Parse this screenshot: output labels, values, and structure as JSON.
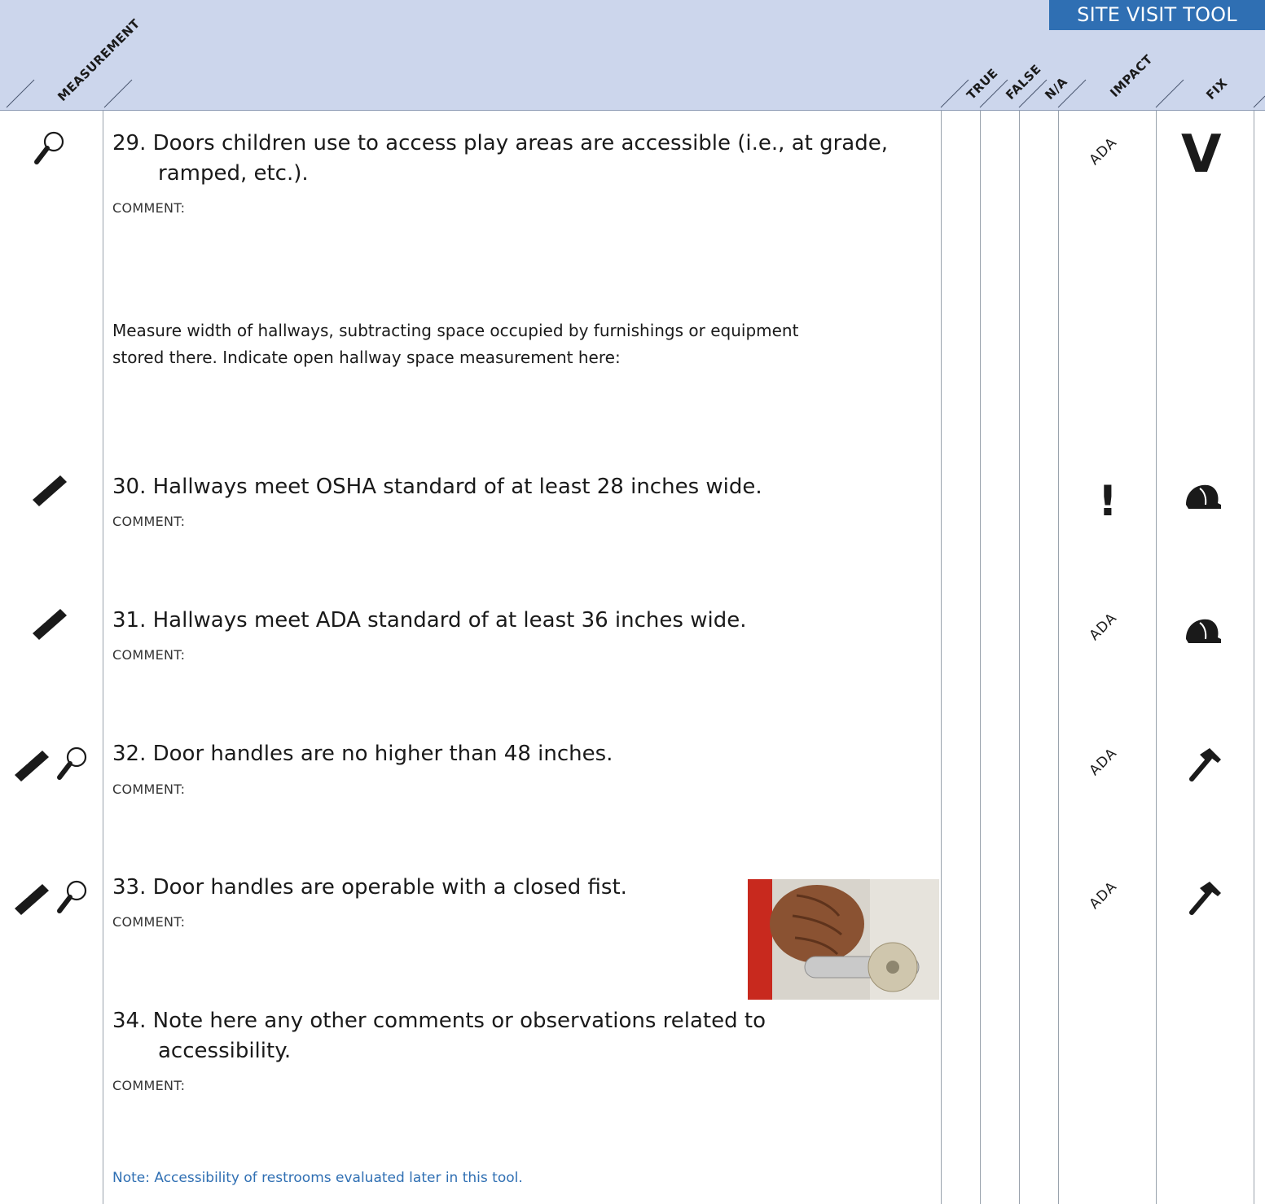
{
  "banner": "SITE VISIT TOOL",
  "columns": {
    "measurement": "MEASUREMENT",
    "true": "TRUE",
    "false": "FALSE",
    "na": "N/A",
    "impact": "IMPACT",
    "fix": "FIX"
  },
  "comment_label": "COMMENT:",
  "items": [
    {
      "line1": "29. Doors children use to access play areas are accessible (i.e., at grade,",
      "line2": "ramped, etc.).",
      "measurement_icons": [
        "magnifier-icon"
      ],
      "impact": "ADA",
      "fix": "V"
    },
    {
      "line1": "30. Hallways meet OSHA standard of at least 28 inches wide.",
      "measurement_icons": [
        "ruler-icon"
      ],
      "impact": "!",
      "fix": "hard-hat-icon"
    },
    {
      "line1": "31. Hallways meet ADA standard of at least 36 inches wide.",
      "measurement_icons": [
        "ruler-icon"
      ],
      "impact": "ADA",
      "fix": "hard-hat-icon"
    },
    {
      "line1": "32. Door handles are no higher than 48 inches.",
      "measurement_icons": [
        "ruler-icon",
        "magnifier-icon"
      ],
      "impact": "ADA",
      "fix": "hammer-icon"
    },
    {
      "line1": "33. Door handles are operable with a closed fist.",
      "measurement_icons": [
        "ruler-icon",
        "magnifier-icon"
      ],
      "impact": "ADA",
      "fix": "hammer-icon"
    },
    {
      "line1": "34. Note here any other comments or observations related to",
      "line2": "accessibility."
    }
  ],
  "instruction": {
    "line1": "Measure width of hallways, subtracting space occupied by furnishings or equipment",
    "line2": "stored there. Indicate open hallway space measurement here:"
  },
  "note": "Note: Accessibility of restrooms evaluated later in this tool.",
  "colors": {
    "header_bg": "#ccd6ec",
    "banner_bg": "#2f6fb3",
    "note_text": "#2f6fb3"
  }
}
